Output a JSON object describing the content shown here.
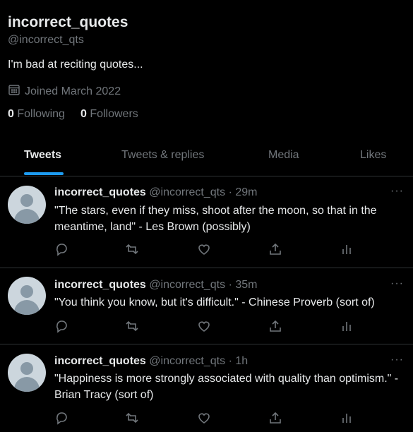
{
  "profile": {
    "name": "incorrect_quotes",
    "handle": "@incorrect_qts",
    "bio": "I'm bad at reciting quotes...",
    "joined": "Joined March 2022",
    "following_count": "0",
    "following_label": "Following",
    "followers_count": "0",
    "followers_label": "Followers"
  },
  "tabs": [
    {
      "label": "Tweets"
    },
    {
      "label": "Tweets & replies"
    },
    {
      "label": "Media"
    },
    {
      "label": "Likes"
    }
  ],
  "tweets": [
    {
      "name": "incorrect_quotes",
      "handle": "@incorrect_qts",
      "time": "· 29m",
      "text": "\"The stars, even if they miss, shoot after the moon, so that in the meantime, land\" - Les Brown (possibly)"
    },
    {
      "name": "incorrect_quotes",
      "handle": "@incorrect_qts",
      "time": "· 35m",
      "text": "\"You think you know, but it's difficult.\" - Chinese Proverb (sort of)"
    },
    {
      "name": "incorrect_quotes",
      "handle": "@incorrect_qts",
      "time": "· 1h",
      "text": "\"Happiness is more strongly associated with quality than optimism.\" - Brian Tracy (sort of)"
    }
  ],
  "more_glyph": "···",
  "colors": {
    "accent": "#1d9bf0",
    "muted": "#71767b",
    "text": "#e7e9ea",
    "border": "#2f3336"
  }
}
